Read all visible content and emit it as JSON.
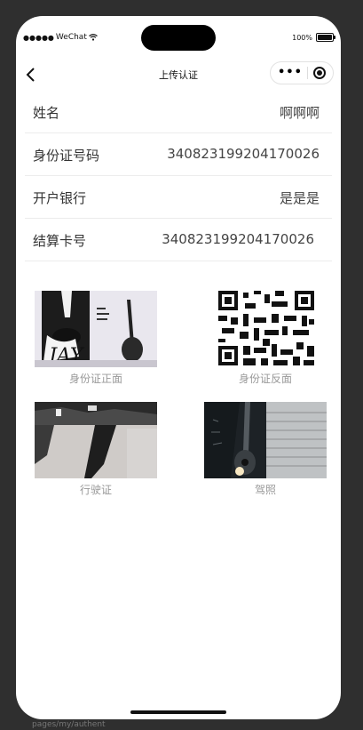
{
  "status_bar": {
    "carrier": "WeChat",
    "battery": "100%"
  },
  "nav": {
    "title": "上传认证"
  },
  "info_rows": [
    {
      "label": "姓名",
      "value": "啊啊啊"
    },
    {
      "label": "身份证号码",
      "value": "340823199204170026"
    },
    {
      "label": "开户银行",
      "value": "是是是"
    },
    {
      "label": "结算卡号",
      "value": "340823199204170026"
    }
  ],
  "photos": [
    {
      "caption": "身份证正面"
    },
    {
      "caption": "身份证反面"
    },
    {
      "caption": "行驶证"
    },
    {
      "caption": "驾照"
    }
  ],
  "devtools": {
    "path": "pages/my/authent"
  }
}
